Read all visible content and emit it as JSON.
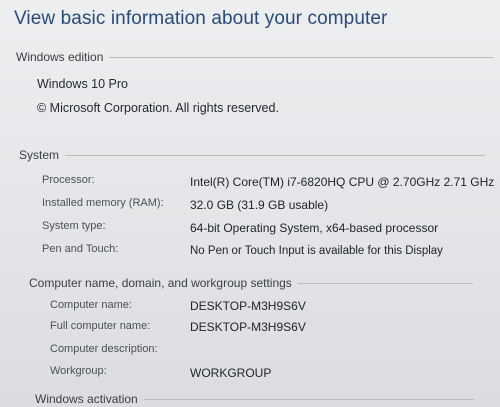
{
  "title": "View basic information about your computer",
  "windows_edition": {
    "heading": "Windows edition",
    "edition": "Windows 10 Pro",
    "copyright": "© Microsoft Corporation. All rights reserved."
  },
  "system": {
    "heading": "System",
    "rows": [
      {
        "label": "Processor:",
        "value": "Intel(R) Core(TM) i7-6820HQ CPU @ 2.70GHz   2.71 GHz"
      },
      {
        "label": "Installed memory (RAM):",
        "value": "32.0 GB (31.9 GB usable)"
      },
      {
        "label": "System type:",
        "value": "64-bit Operating System, x64-based processor"
      },
      {
        "label": "Pen and Touch:",
        "value": "No Pen or Touch Input is available for this Display"
      }
    ]
  },
  "computer_name": {
    "heading": "Computer name, domain, and workgroup settings",
    "rows": [
      {
        "label": "Computer name:",
        "value": "DESKTOP-M3H9S6V"
      },
      {
        "label": "Full computer name:",
        "value": "DESKTOP-M3H9S6V"
      },
      {
        "label": "Computer description:",
        "value": ""
      },
      {
        "label": "Workgroup:",
        "value": "WORKGROUP"
      }
    ]
  },
  "windows_activation": {
    "heading": "Windows activation"
  }
}
